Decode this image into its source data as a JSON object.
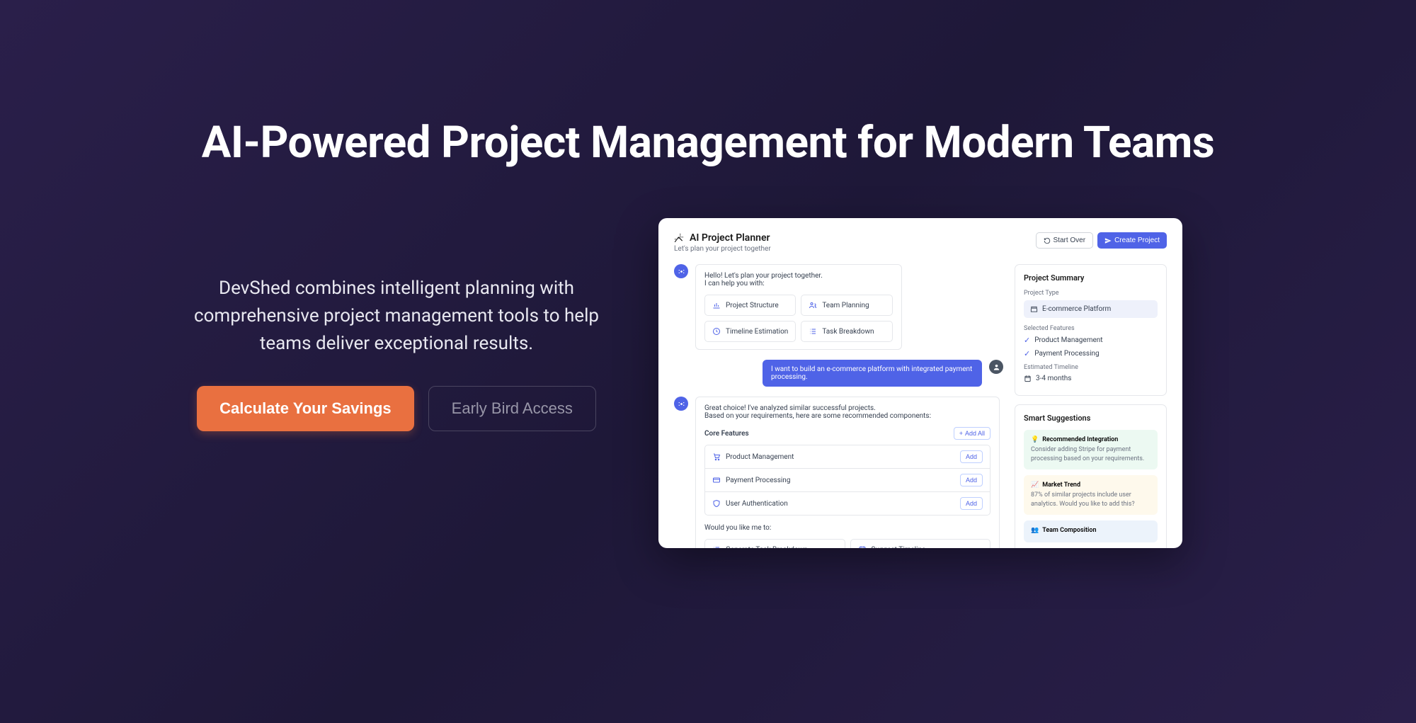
{
  "hero": {
    "title": "AI-Powered Project Management for Modern Teams",
    "subtitle": "DevShed combines intelligent planning with comprehensive project management tools to help teams deliver exceptional results.",
    "cta_primary": "Calculate Your Savings",
    "cta_secondary": "Early Bird Access"
  },
  "mockup": {
    "header": {
      "title": "AI Project Planner",
      "subtitle": "Let's plan your project together",
      "start_over": "Start Over",
      "create_project": "Create Project"
    },
    "chat": {
      "ai1_line1": "Hello! Let's plan your project together.",
      "ai1_line2": "I can help you with:",
      "tiles": [
        {
          "label": "Project Structure"
        },
        {
          "label": "Team Planning"
        },
        {
          "label": "Timeline Estimation"
        },
        {
          "label": "Task Breakdown"
        }
      ],
      "user1": "I want to build an e-commerce platform with integrated payment processing.",
      "ai2_line1": "Great choice! I've analyzed similar successful projects.",
      "ai2_line2": "Based on your requirements, here are some recommended components:",
      "core_features_label": "Core Features",
      "add_all": "Add All",
      "features": [
        {
          "label": "Product Management",
          "add": "Add"
        },
        {
          "label": "Payment Processing",
          "add": "Add"
        },
        {
          "label": "User Authentication",
          "add": "Add"
        }
      ],
      "prompt": "Would you like me to:",
      "actions": [
        {
          "label": "Generate Task Breakdown"
        },
        {
          "label": "Suggest Timeline"
        }
      ]
    },
    "summary": {
      "title": "Project Summary",
      "type_label": "Project Type",
      "type_value": "E-commerce Platform",
      "features_label": "Selected Features",
      "features": [
        "Product Management",
        "Payment Processing"
      ],
      "timeline_label": "Estimated Timeline",
      "timeline_value": "3-4 months"
    },
    "suggestions": {
      "title": "Smart Suggestions",
      "items": [
        {
          "title": "Recommended Integration",
          "body": "Consider adding Stripe for payment processing based on your requirements."
        },
        {
          "title": "Market Trend",
          "body": "87% of similar projects include user analytics. Would you like to add this?"
        },
        {
          "title": "Team Composition",
          "body": ""
        }
      ]
    }
  }
}
